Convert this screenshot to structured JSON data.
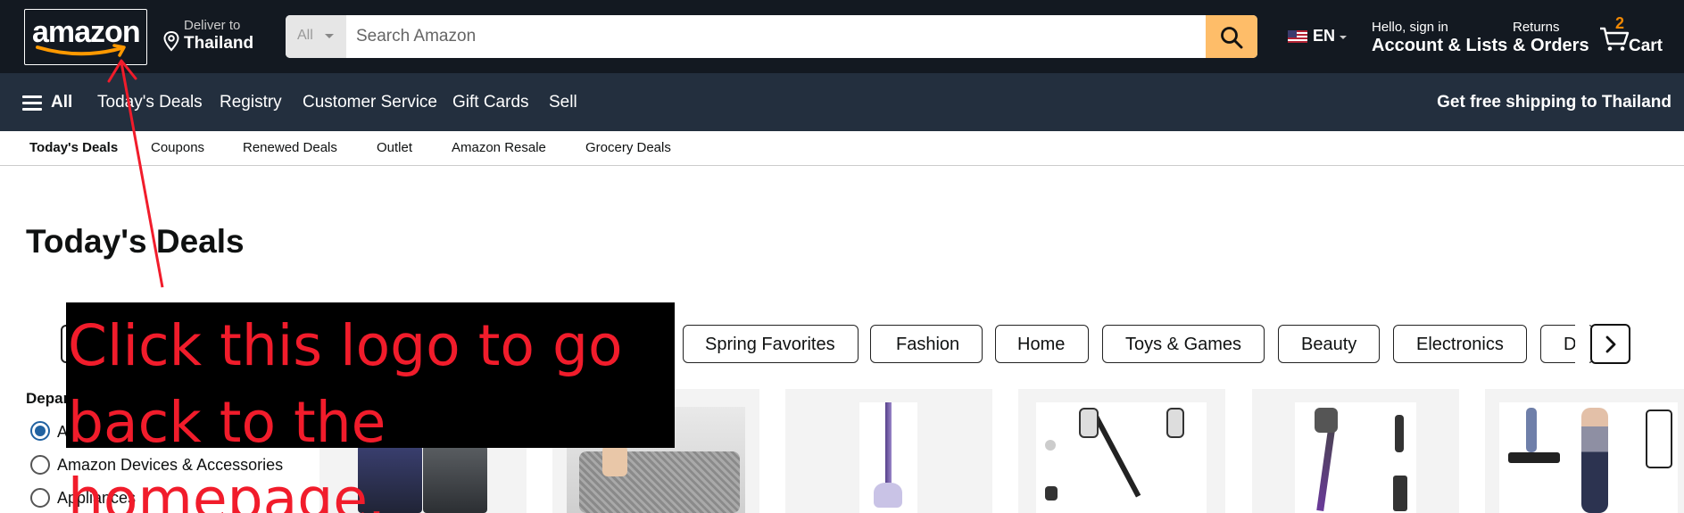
{
  "header": {
    "logo_text": "amazon",
    "deliver_label": "Deliver to",
    "deliver_location": "Thailand",
    "search": {
      "category": "All",
      "placeholder": "Search Amazon"
    },
    "language": "EN",
    "account": {
      "greeting": "Hello, sign in",
      "label": "Account & Lists"
    },
    "orders": {
      "line1": "Returns",
      "line2": "& Orders"
    },
    "cart": {
      "count": "2",
      "label": "Cart"
    }
  },
  "nav": {
    "all_label": "All",
    "items": [
      "Today's Deals",
      "Registry",
      "Customer Service",
      "Gift Cards",
      "Sell"
    ],
    "shipping_promo": "Get free shipping to Thailand"
  },
  "deals_nav": {
    "items": [
      "Today's Deals",
      "Coupons",
      "Renewed Deals",
      "Outlet",
      "Amazon Resale",
      "Grocery Deals"
    ]
  },
  "page_title": "Today's Deals",
  "categories": [
    "Spring Favorites",
    "Fashion",
    "Home",
    "Toys & Games",
    "Beauty",
    "Electronics",
    "D"
  ],
  "department_filter": {
    "heading": "Depar",
    "options": [
      {
        "label": "A",
        "checked": true
      },
      {
        "label": "Amazon Devices & Accessories",
        "checked": false
      },
      {
        "label": "Appliances",
        "checked": false
      }
    ]
  },
  "annotation": {
    "text": "Click this logo to go back to the homepage.",
    "color": "#f11c2b"
  },
  "colors": {
    "header_bg": "#131921",
    "subnav_bg": "#232f3e",
    "search_button": "#febd69",
    "cart_count": "#f08804",
    "radio_selected": "#2162a1"
  }
}
